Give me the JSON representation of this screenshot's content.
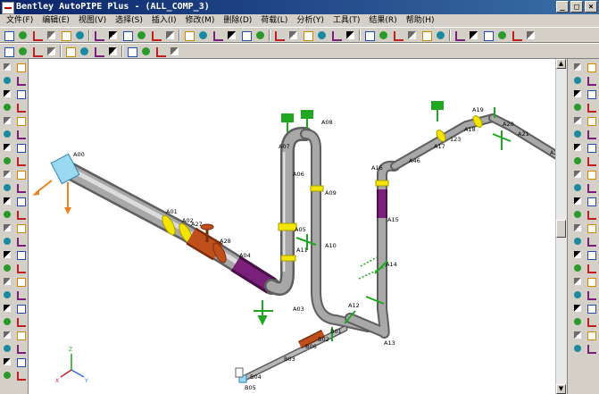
{
  "window": {
    "title": "Bentley AutoPIPE Plus - (ALL_COMP_3)",
    "controls": [
      "_",
      "□",
      "×"
    ]
  },
  "menu": [
    "文件(F)",
    "编辑(E)",
    "视图(V)",
    "选择(S)",
    "插入(I)",
    "修改(M)",
    "删除(D)",
    "荷载(L)",
    "分析(Y)",
    "工具(T)",
    "结果(R)",
    "帮助(H)"
  ],
  "colors": {
    "pipe": "#9a9a9a",
    "pipe_dark": "#6a6a6a",
    "pipe_light": "#d8d8d8",
    "flange": "#f2e600",
    "support": "#1fa81f",
    "valve": "#c0501b",
    "insulation": "#7a1f7a",
    "anchor": "#f08020",
    "label": "#000000"
  },
  "nodes": {
    "A00": "A00",
    "A01": "A01",
    "A02": "A02",
    "A27": "A27",
    "A28": "A28",
    "A04": "A04",
    "A03": "A03",
    "A05": "A05",
    "A06": "A06",
    "A07": "A07",
    "A08": "A08",
    "A09": "A09",
    "A10": "A10",
    "A11": "A11",
    "A12": "A12",
    "A13": "A13",
    "A14": "A14",
    "A15": "A15",
    "A16": "A16",
    "A46": "A46",
    "A17": "A17",
    "A18": "A18",
    "A19": "A19",
    "A20": "A20",
    "A21": "A21",
    "A2": "A2",
    "n123": "123",
    "B01": "B01",
    "B02": "B02",
    "B06": "B06",
    "B03": "B03",
    "B04": "B04",
    "B05": "B05"
  },
  "axes": {
    "x": "X",
    "y": "Y",
    "z": "Z"
  }
}
